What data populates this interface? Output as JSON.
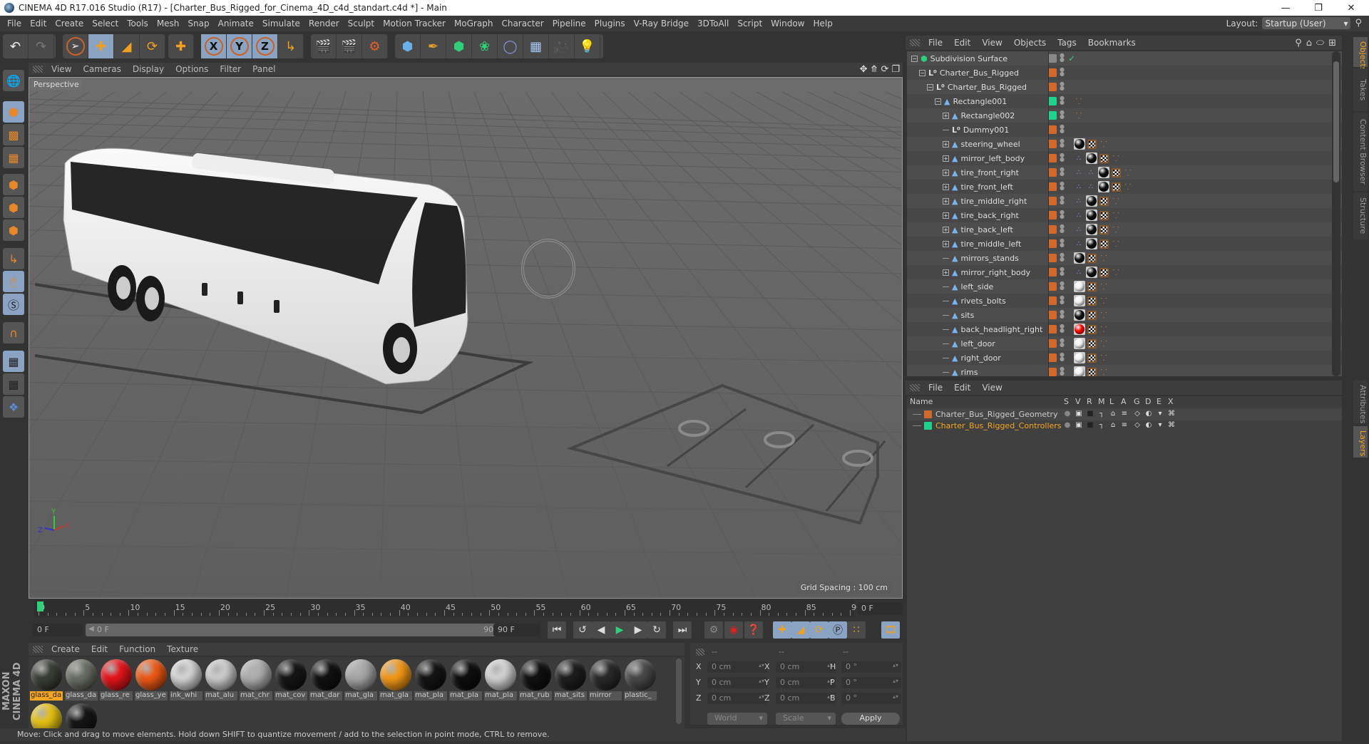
{
  "window": {
    "title": "CINEMA 4D R17.016 Studio (R17) - [Charter_Bus_Rigged_for_Cinema_4D_c4d_standart.c4d *] - Main",
    "controls": [
      "minimize",
      "restore",
      "close"
    ]
  },
  "menubar": {
    "items": [
      "File",
      "Edit",
      "Create",
      "Select",
      "Tools",
      "Mesh",
      "Snap",
      "Animate",
      "Simulate",
      "Render",
      "Sculpt",
      "Motion Tracker",
      "MoGraph",
      "Character",
      "Pipeline",
      "Plugins",
      "V-Ray Bridge",
      "3DToAll",
      "Script",
      "Window",
      "Help"
    ],
    "layout_label": "Layout:",
    "layout_value": "Startup (User)"
  },
  "toolbar": {
    "groups": [
      [
        "undo-icon",
        "redo-icon"
      ],
      [
        "live-selection-icon",
        "move-icon",
        "scale-icon",
        "rotate-icon"
      ],
      [
        "last-tool-icon"
      ],
      [
        "x-axis-icon",
        "y-axis-icon",
        "z-axis-icon",
        "coordinate-system-icon"
      ],
      [
        "render-view-icon",
        "render-picture-viewer-icon",
        "render-settings-icon"
      ],
      [
        "cube-icon",
        "pen-icon",
        "subdivision-icon",
        "cloner-icon",
        "deformer-icon",
        "floor-icon",
        "camera-icon",
        "light-icon"
      ]
    ],
    "axis_labels": [
      "X",
      "Y",
      "Z"
    ]
  },
  "leftbar": {
    "tools": [
      "make-editable-icon",
      "model-mode-icon",
      "texture-mode-icon",
      "workplane-mode-icon",
      "points-mode-icon",
      "edges-mode-icon",
      "polygons-mode-icon",
      "axis-mode-icon",
      "tweak-mode-icon",
      "solo-icon",
      "snap-icon",
      "workplane-lock-icon",
      "workplane-align-icon",
      "python-icon"
    ]
  },
  "viewport": {
    "menu": [
      "View",
      "Cameras",
      "Display",
      "Options",
      "Filter",
      "Panel"
    ],
    "camera_label": "Perspective",
    "grid_spacing": "Grid Spacing : 100 cm",
    "axis_labels": {
      "x": "X",
      "y": "Y",
      "z": "Z"
    }
  },
  "timeline": {
    "ticks": [
      "0",
      "5",
      "10",
      "15",
      "20",
      "25",
      "30",
      "35",
      "40",
      "45",
      "50",
      "55",
      "60",
      "65",
      "70",
      "75",
      "80",
      "85",
      "90"
    ],
    "current_frame": "0 F",
    "start_field": "0 F",
    "range_start": "0 F",
    "range_end": "90 F",
    "end_field": "90 F",
    "playhead_frame": 0,
    "max_frame": 90
  },
  "material_manager": {
    "menu": [
      "Create",
      "Edit",
      "Function",
      "Texture"
    ],
    "materials": [
      {
        "label": "glass_da",
        "color": "#3d4038",
        "selected": true
      },
      {
        "label": "glass_da",
        "color": "#6c7064",
        "selected": false
      },
      {
        "label": "glass_re",
        "color": "#e8151a",
        "selected": false
      },
      {
        "label": "glass_ye",
        "color": "#f25a14",
        "selected": false
      },
      {
        "label": "ink_whi",
        "color": "#d8d8d8",
        "selected": false
      },
      {
        "label": "mat_alu",
        "color": "#cfcfcf",
        "selected": false
      },
      {
        "label": "mat_chr",
        "color": "#b0b0b0",
        "selected": false
      },
      {
        "label": "mat_cov",
        "color": "#161616",
        "selected": false
      },
      {
        "label": "mat_dar",
        "color": "#111111",
        "selected": false
      },
      {
        "label": "mat_gla",
        "color": "#a8a8a8",
        "selected": false
      },
      {
        "label": "mat_gla",
        "color": "#f79a14",
        "selected": false
      },
      {
        "label": "mat_pla",
        "color": "#141414",
        "selected": false
      },
      {
        "label": "mat_pla",
        "color": "#0e0e0e",
        "selected": false
      },
      {
        "label": "mat_pla",
        "color": "#d6d6d6",
        "selected": false
      },
      {
        "label": "mat_rub",
        "color": "#101010",
        "selected": false
      },
      {
        "label": "mat_sits",
        "color": "#1e1e1e",
        "selected": false
      },
      {
        "label": "mirror",
        "color": "#2a2a2a",
        "selected": false
      },
      {
        "label": "plastic_",
        "color": "#4a4a4a",
        "selected": false
      },
      {
        "label": "",
        "color": "#e8c414",
        "selected": false
      },
      {
        "label": "",
        "color": "#161616",
        "selected": false
      }
    ],
    "logo_text": "MAXON CINEMA 4D"
  },
  "coordinates": {
    "headers": [
      "--",
      "--",
      "--"
    ],
    "position": [
      {
        "axis": "X",
        "value": "0 cm"
      },
      {
        "axis": "Y",
        "value": "0 cm"
      },
      {
        "axis": "Z",
        "value": "0 cm"
      }
    ],
    "size": [
      {
        "axis": "X",
        "value": "0 cm"
      },
      {
        "axis": "Y",
        "value": "0 cm"
      },
      {
        "axis": "Z",
        "value": "0 cm"
      }
    ],
    "rotation": [
      {
        "axis": "H",
        "value": "0 °"
      },
      {
        "axis": "P",
        "value": "0 °"
      },
      {
        "axis": "B",
        "value": "0 °"
      }
    ],
    "coord_system": "World",
    "size_mode": "Scale",
    "apply_label": "Apply"
  },
  "status_bar": {
    "text": "Move: Click and drag to move elements. Hold down SHIFT to quantize movement / add to the selection in point mode, CTRL to remove."
  },
  "object_manager": {
    "menu": [
      "File",
      "Edit",
      "View",
      "Objects",
      "Tags",
      "Bookmarks"
    ],
    "objects": [
      {
        "name": "Subdivision Surface",
        "depth": 0,
        "expand": "minus",
        "icon": "subdivision",
        "color": "none",
        "tags": [
          "check"
        ]
      },
      {
        "name": "Charter_Bus_Rigged",
        "depth": 1,
        "expand": "minus",
        "icon": "null",
        "color": "#d2692a",
        "tags": []
      },
      {
        "name": "Charter_Bus_Rigged",
        "depth": 2,
        "expand": "minus",
        "icon": "null",
        "color": "#d2692a",
        "tags": []
      },
      {
        "name": "Rectangle001",
        "depth": 3,
        "expand": "minus",
        "icon": "polygon",
        "color": "#1fd38f",
        "tags": [
          "nodes"
        ]
      },
      {
        "name": "Rectangle002",
        "depth": 4,
        "expand": "plus",
        "icon": "polygon",
        "color": "#1fd38f",
        "tags": [
          "nodes"
        ]
      },
      {
        "name": "Dummy001",
        "depth": 4,
        "expand": "none",
        "icon": "null",
        "color": "#d2692a",
        "tags": []
      },
      {
        "name": "steering_wheel",
        "depth": 4,
        "expand": "plus",
        "icon": "polygon",
        "color": "#d2692a",
        "tags": [
          "mat:#111",
          "tex",
          "nodes"
        ]
      },
      {
        "name": "mirror_left_body",
        "depth": 4,
        "expand": "plus",
        "icon": "polygon",
        "color": "#d2692a",
        "tags": [
          "ik",
          "mat:#111",
          "tex",
          "nodes"
        ]
      },
      {
        "name": "tire_front_right",
        "depth": 4,
        "expand": "plus",
        "icon": "polygon",
        "color": "#d2692a",
        "tags": [
          "ik",
          "ik",
          "mat:#111",
          "tex",
          "nodes"
        ]
      },
      {
        "name": "tire_front_left",
        "depth": 4,
        "expand": "plus",
        "icon": "polygon",
        "color": "#d2692a",
        "tags": [
          "ik",
          "ik",
          "mat:#111",
          "tex",
          "nodes"
        ]
      },
      {
        "name": "tire_middle_right",
        "depth": 4,
        "expand": "plus",
        "icon": "polygon",
        "color": "#d2692a",
        "tags": [
          "ik",
          "mat:#111",
          "tex",
          "nodes"
        ]
      },
      {
        "name": "tire_back_right",
        "depth": 4,
        "expand": "plus",
        "icon": "polygon",
        "color": "#d2692a",
        "tags": [
          "ik",
          "mat:#111",
          "tex",
          "nodes"
        ]
      },
      {
        "name": "tire_back_left",
        "depth": 4,
        "expand": "plus",
        "icon": "polygon",
        "color": "#d2692a",
        "tags": [
          "ik",
          "mat:#111",
          "tex",
          "nodes"
        ]
      },
      {
        "name": "tire_middle_left",
        "depth": 4,
        "expand": "plus",
        "icon": "polygon",
        "color": "#d2692a",
        "tags": [
          "ik",
          "mat:#111",
          "tex",
          "nodes"
        ]
      },
      {
        "name": "mirrors_stands",
        "depth": 4,
        "expand": "none",
        "icon": "polygon",
        "color": "#d2692a",
        "tags": [
          "mat:#111",
          "tex",
          "nodes"
        ]
      },
      {
        "name": "mirror_right_body",
        "depth": 4,
        "expand": "plus",
        "icon": "polygon",
        "color": "#d2692a",
        "tags": [
          "ik",
          "mat:#111",
          "tex",
          "nodes"
        ]
      },
      {
        "name": "left_side",
        "depth": 4,
        "expand": "none",
        "icon": "polygon",
        "color": "#d2692a",
        "tags": [
          "mat:#eee",
          "tex",
          "nodes"
        ]
      },
      {
        "name": "rivets_bolts",
        "depth": 4,
        "expand": "none",
        "icon": "polygon",
        "color": "#d2692a",
        "tags": [
          "mat:#eee",
          "tex",
          "nodes"
        ]
      },
      {
        "name": "sits",
        "depth": 4,
        "expand": "none",
        "icon": "polygon",
        "color": "#d2692a",
        "tags": [
          "mat:#111",
          "tex",
          "nodes"
        ]
      },
      {
        "name": "back_headlight_right",
        "depth": 4,
        "expand": "none",
        "icon": "polygon",
        "color": "#d2692a",
        "tags": [
          "mat:#f00",
          "tex",
          "nodes"
        ]
      },
      {
        "name": "left_door",
        "depth": 4,
        "expand": "none",
        "icon": "polygon",
        "color": "#d2692a",
        "tags": [
          "mat:#eee",
          "tex",
          "nodes"
        ]
      },
      {
        "name": "right_door",
        "depth": 4,
        "expand": "none",
        "icon": "polygon",
        "color": "#d2692a",
        "tags": [
          "mat:#eee",
          "tex",
          "nodes"
        ]
      },
      {
        "name": "rims",
        "depth": 4,
        "expand": "none",
        "icon": "polygon",
        "color": "#d2692a",
        "tags": [
          "mat:#eee",
          "tex",
          "nodes"
        ]
      }
    ],
    "header_icons": [
      "search-icon",
      "home-icon",
      "link-icon",
      "new-panel-icon"
    ]
  },
  "right_tabs": {
    "top": [
      {
        "label": "Objects",
        "active": true
      },
      {
        "label": "Takes",
        "active": false
      },
      {
        "label": "Content Browser",
        "active": false
      },
      {
        "label": "Structure",
        "active": false
      }
    ],
    "bottom": [
      {
        "label": "Attributes",
        "active": false
      },
      {
        "label": "Layers",
        "active": true
      }
    ]
  },
  "layer_manager": {
    "menu": [
      "File",
      "Edit",
      "View"
    ],
    "columns": [
      "Name",
      "S",
      "V",
      "R",
      "M",
      "L",
      "A",
      "G",
      "D",
      "E",
      "X"
    ],
    "layers": [
      {
        "name": "Charter_Bus_Rigged_Geometry",
        "color": "#d2692a",
        "text_color": "#cccccc"
      },
      {
        "name": "Charter_Bus_Rigged_Controllers",
        "color": "#1fd38f",
        "text_color": "#f5a623"
      }
    ]
  }
}
